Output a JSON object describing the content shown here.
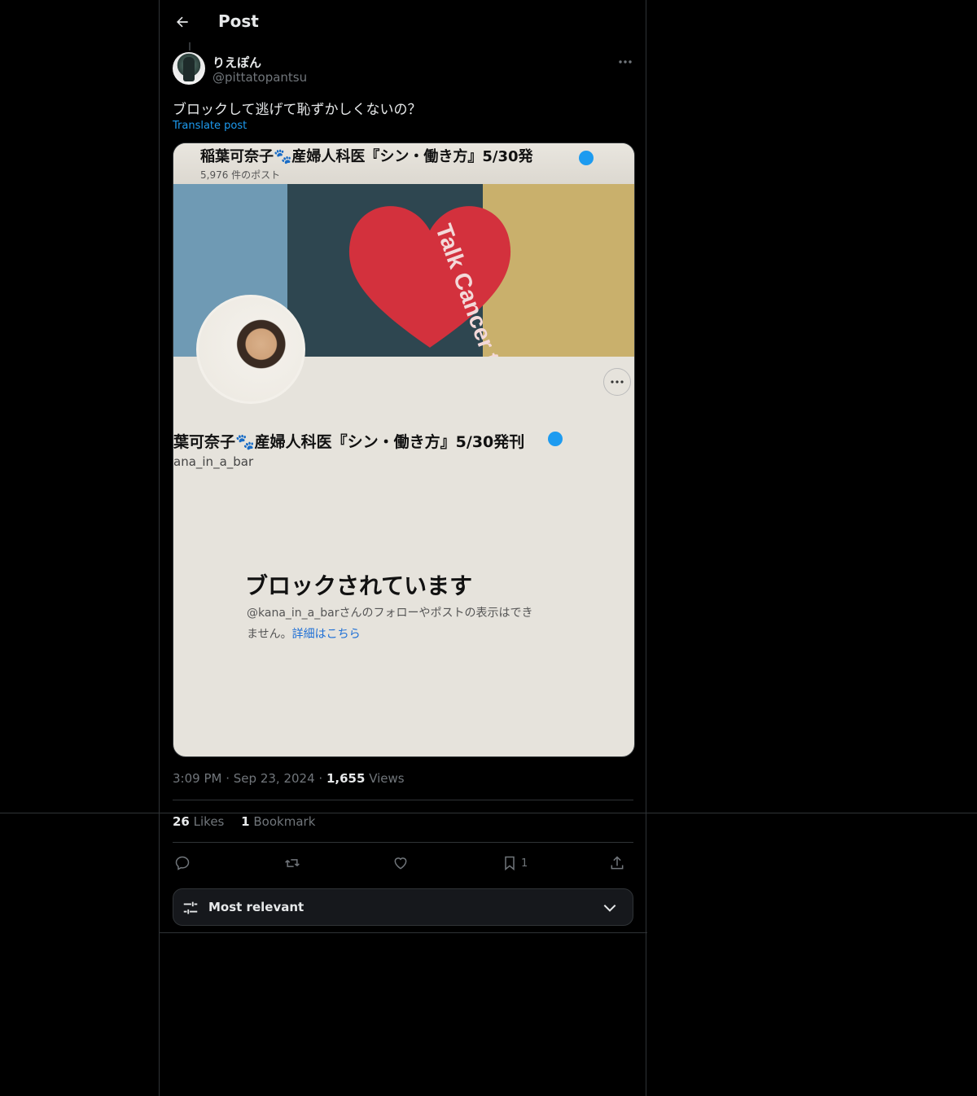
{
  "header": {
    "title": "Post"
  },
  "post": {
    "author_name": "りえぽん",
    "author_handle": "@pittatopantsu",
    "text": "ブロックして逃げて恥ずかしくないの？",
    "translate_label": "Translate post",
    "time": "3:09 PM",
    "date": "Sep 23, 2024",
    "views_count": "1,655",
    "views_label": "Views",
    "likes_count": "26",
    "likes_label": "Likes",
    "bookmarks_count": "1",
    "bookmarks_label": "Bookmark",
    "bookmark_action_count": "1"
  },
  "media": {
    "header_title": "稲葉可奈子🐾産婦人科医『シン・働き方』5/30発",
    "header_posts": "5,976 件のポスト",
    "profile_name": "葉可奈子🐾産婦人科医『シン・働き方』5/30発刊",
    "profile_handle": "ana_in_a_bar",
    "blocked_title": "ブロックされています",
    "blocked_desc_1": "@kana_in_a_barさんのフォローやポストの表示はでき",
    "blocked_desc_2": "ません。",
    "blocked_link": "詳細はこちら",
    "banner_text": "Talk Cancer to Save Us"
  },
  "sort": {
    "label": "Most relevant"
  },
  "colors": {
    "accent": "#1d9bf0",
    "bg": "#000000",
    "muted": "#71767b",
    "border": "#2f3336"
  }
}
